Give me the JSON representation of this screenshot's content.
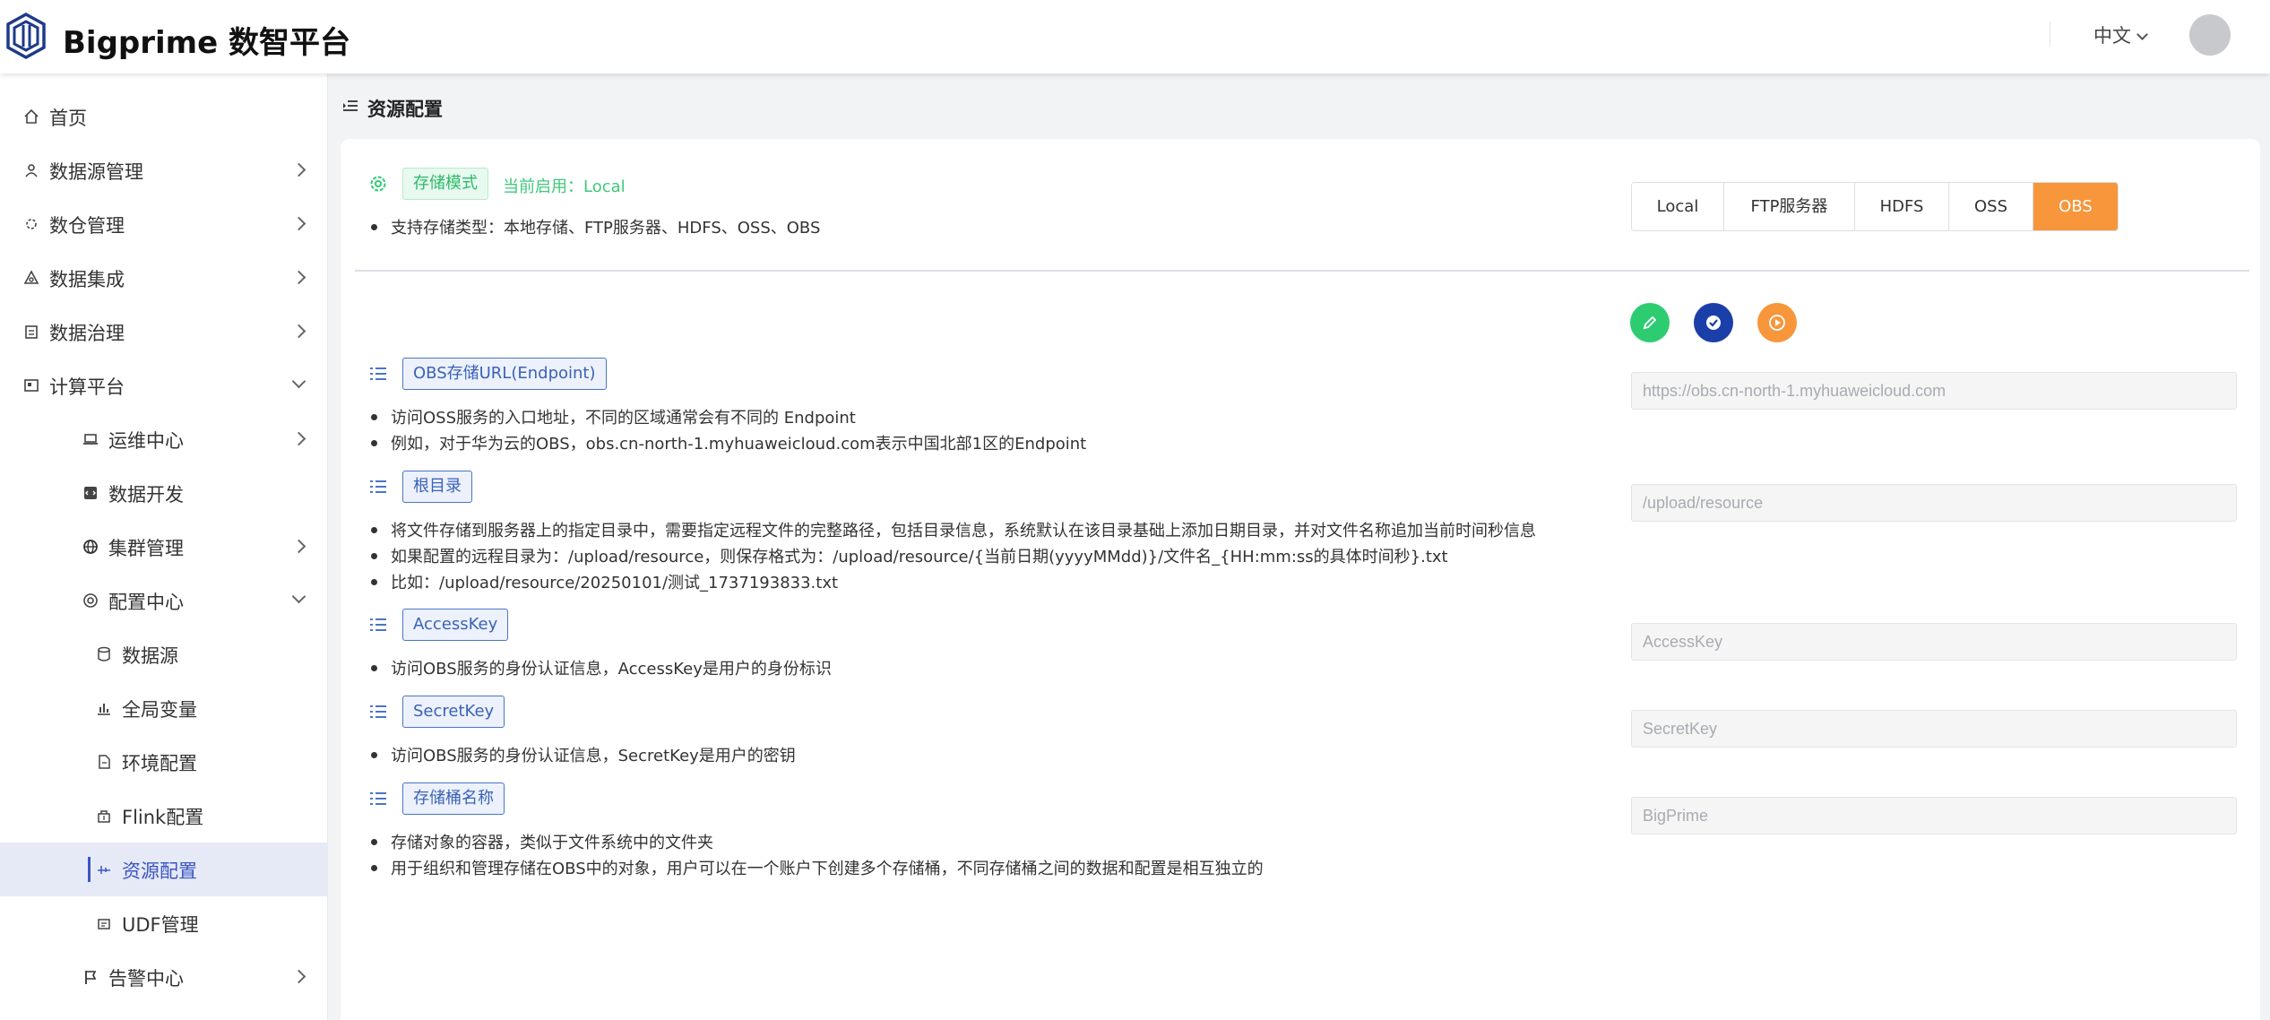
{
  "header": {
    "brand": "Bigprime 数智平台",
    "language": "中文"
  },
  "sidebar": {
    "items": [
      {
        "label": "首页",
        "icon": "home-icon"
      },
      {
        "label": "数据源管理",
        "icon": "datasource-icon"
      },
      {
        "label": "数仓管理",
        "icon": "warehouse-icon"
      },
      {
        "label": "数据集成",
        "icon": "integration-icon"
      },
      {
        "label": "数据治理",
        "icon": "governance-icon"
      },
      {
        "label": "计算平台",
        "icon": "compute-icon"
      },
      {
        "label": "运维中心",
        "icon": "laptop-icon"
      },
      {
        "label": "数据开发",
        "icon": "code-icon"
      },
      {
        "label": "集群管理",
        "icon": "globe-icon"
      },
      {
        "label": "配置中心",
        "icon": "target-icon"
      },
      {
        "label": "数据源",
        "icon": "database-icon"
      },
      {
        "label": "全局变量",
        "icon": "bar-chart-icon"
      },
      {
        "label": "环境配置",
        "icon": "file-icon"
      },
      {
        "label": "Flink配置",
        "icon": "flink-icon"
      },
      {
        "label": "资源配置",
        "icon": "resource-icon"
      },
      {
        "label": "UDF管理",
        "icon": "udf-icon"
      },
      {
        "label": "告警中心",
        "icon": "flag-icon"
      }
    ]
  },
  "breadcrumb": {
    "title": "资源配置"
  },
  "storage": {
    "mode_tag": "存储模式",
    "current": "当前启用：Local",
    "types_note": "支持存储类型：本地存储、FTP服务器、HDFS、OSS、OBS",
    "options": [
      "Local",
      "FTP服务器",
      "HDFS",
      "OSS",
      "OBS"
    ],
    "selected": "OBS"
  },
  "colors": {
    "accent_orange": "#f7963b",
    "success_green": "#2ecc71",
    "primary_blue": "#1b3fa8",
    "tag_blue": "#4a75c9"
  },
  "sections": {
    "endpoint": {
      "tag": "OBS存储URL(Endpoint)",
      "lines": [
        "访问OSS服务的入口地址，不同的区域通常会有不同的 Endpoint",
        "例如，对于华为云的OBS，obs.cn-north-1.myhuaweicloud.com表示中国北部1区的Endpoint"
      ],
      "placeholder": "https://obs.cn-north-1.myhuaweicloud.com"
    },
    "root": {
      "tag": "根目录",
      "lines": [
        "将文件存储到服务器上的指定目录中，需要指定远程文件的完整路径，包括目录信息，系统默认在该目录基础上添加日期目录，并对文件名称追加当前时间秒信息",
        "如果配置的远程目录为：/upload/resource，则保存格式为：/upload/resource/{当前日期(yyyyMMdd)}/文件名_{HH:mm:ss的具体时间秒}.txt",
        "比如：/upload/resource/20250101/测试_1737193833.txt"
      ],
      "placeholder": "/upload/resource"
    },
    "access_key": {
      "tag": "AccessKey",
      "lines": [
        "访问OBS服务的身份认证信息，AccessKey是用户的身份标识"
      ],
      "placeholder": "AccessKey"
    },
    "secret_key": {
      "tag": "SecretKey",
      "lines": [
        "访问OBS服务的身份认证信息，SecretKey是用户的密钥"
      ],
      "placeholder": "SecretKey"
    },
    "bucket": {
      "tag": "存储桶名称",
      "lines": [
        "存储对象的容器，类似于文件系统中的文件夹",
        "用于组织和管理存储在OBS中的对象，用户可以在一个账户下创建多个存储桶，不同存储桶之间的数据和配置是相互独立的"
      ],
      "placeholder": "BigPrime"
    }
  }
}
